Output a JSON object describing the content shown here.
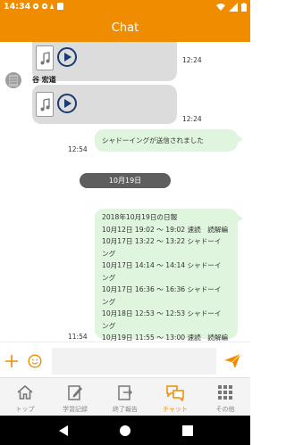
{
  "status_bar": {
    "time": "14:34"
  },
  "app_bar": {
    "title": "Chat"
  },
  "messages": [
    {
      "type": "audio",
      "time": "12:24"
    },
    {
      "type": "audio",
      "sender": "谷 宏道",
      "time": "12:24"
    },
    {
      "type": "text",
      "text": "シャドーイングが送信されました",
      "time": "12:54"
    },
    {
      "type": "date_divider",
      "text": "10月19日"
    },
    {
      "type": "text",
      "time": "11:54",
      "lines": [
        "2018年10月19日の日報",
        "10月12日 19:02 〜 19:02 速読　読解編",
        "10月17日 13:22 〜 13:22 シャドーイ",
        "ング",
        "10月17日 14:14 〜 14:14 シャドーイ",
        "ング",
        "10月17日 16:36 〜 16:36 シャドーイ",
        "ング",
        "10月18日 12:53 〜 12:53 シャドーイ",
        "ング",
        "10月19日 11:55 〜 13:00 速読　読解編"
      ]
    }
  ],
  "input": {
    "value": "",
    "placeholder": ""
  },
  "nav": [
    {
      "label": "トップ",
      "icon": "home-icon"
    },
    {
      "label": "学習記録",
      "icon": "edit-document-icon"
    },
    {
      "label": "終了報告",
      "icon": "report-icon"
    },
    {
      "label": "チャット",
      "icon": "chat-bubbles-icon",
      "active": true
    },
    {
      "label": "その他",
      "icon": "grid-icon"
    }
  ],
  "colors": {
    "accent": "#f08c00",
    "bubble_green": "#dff5dd",
    "bubble_gray": "#dcdcdc"
  }
}
